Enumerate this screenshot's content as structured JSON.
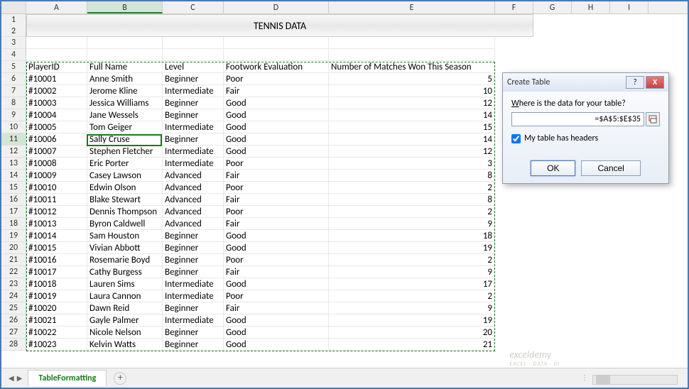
{
  "title_row": "TENNIS DATA",
  "columns": [
    "A",
    "B",
    "C",
    "D",
    "E",
    "F",
    "G",
    "H",
    "I"
  ],
  "selected_column": "B",
  "active_cell": {
    "row": 11,
    "col": "B"
  },
  "headers": {
    "playerid": "PlayerID",
    "fullname": "Full Name",
    "level": "Level",
    "footwork": "Footwork Evaluation",
    "matches": "Number of Matches Won This Season"
  },
  "rows": [
    {
      "n": 6,
      "id": "#10001",
      "name": "Anne Smith",
      "level": "Beginner",
      "foot": "Poor",
      "matches": 5
    },
    {
      "n": 7,
      "id": "#10002",
      "name": "Jerome Kline",
      "level": "Intermediate",
      "foot": "Fair",
      "matches": 10
    },
    {
      "n": 8,
      "id": "#10003",
      "name": "Jessica Williams",
      "level": "Beginner",
      "foot": "Good",
      "matches": 12
    },
    {
      "n": 9,
      "id": "#10004",
      "name": "Jane Wessels",
      "level": "Beginner",
      "foot": "Good",
      "matches": 14
    },
    {
      "n": 10,
      "id": "#10005",
      "name": "Tom Geiger",
      "level": "Intermediate",
      "foot": "Good",
      "matches": 15
    },
    {
      "n": 11,
      "id": "#10006",
      "name": "Sally Cruse",
      "level": "Beginner",
      "foot": "Good",
      "matches": 14
    },
    {
      "n": 12,
      "id": "#10007",
      "name": "Stephen Fletcher",
      "level": "Intermediate",
      "foot": "Good",
      "matches": 12
    },
    {
      "n": 13,
      "id": "#10008",
      "name": "Eric Porter",
      "level": "Intermediate",
      "foot": "Poor",
      "matches": 3
    },
    {
      "n": 14,
      "id": "#10009",
      "name": "Casey Lawson",
      "level": "Advanced",
      "foot": "Fair",
      "matches": 8
    },
    {
      "n": 15,
      "id": "#10010",
      "name": "Edwin Olson",
      "level": "Advanced",
      "foot": "Poor",
      "matches": 2
    },
    {
      "n": 16,
      "id": "#10011",
      "name": "Blake Stewart",
      "level": "Advanced",
      "foot": "Fair",
      "matches": 8
    },
    {
      "n": 17,
      "id": "#10012",
      "name": "Dennis Thompson",
      "level": "Advanced",
      "foot": "Poor",
      "matches": 2
    },
    {
      "n": 18,
      "id": "#10013",
      "name": "Byron Caldwell",
      "level": "Advanced",
      "foot": "Fair",
      "matches": 9
    },
    {
      "n": 19,
      "id": "#10014",
      "name": "Sam Houston",
      "level": "Beginner",
      "foot": "Good",
      "matches": 18
    },
    {
      "n": 20,
      "id": "#10015",
      "name": "Vivian Abbott",
      "level": "Beginner",
      "foot": "Good",
      "matches": 19
    },
    {
      "n": 21,
      "id": "#10016",
      "name": "Rosemarie Boyd",
      "level": "Beginner",
      "foot": "Poor",
      "matches": 2
    },
    {
      "n": 22,
      "id": "#10017",
      "name": "Cathy Burgess",
      "level": "Beginner",
      "foot": "Fair",
      "matches": 9
    },
    {
      "n": 23,
      "id": "#10018",
      "name": "Lauren Sims",
      "level": "Intermediate",
      "foot": "Good",
      "matches": 17
    },
    {
      "n": 24,
      "id": "#10019",
      "name": "Laura Cannon",
      "level": "Intermediate",
      "foot": "Poor",
      "matches": 2
    },
    {
      "n": 25,
      "id": "#10020",
      "name": "Dawn Reid",
      "level": "Beginner",
      "foot": "Fair",
      "matches": 9
    },
    {
      "n": 26,
      "id": "#10021",
      "name": "Gayle Palmer",
      "level": "Intermediate",
      "foot": "Good",
      "matches": 19
    },
    {
      "n": 27,
      "id": "#10022",
      "name": "Nicole Nelson",
      "level": "Beginner",
      "foot": "Good",
      "matches": 20
    },
    {
      "n": 28,
      "id": "#10023",
      "name": "Kelvin Watts",
      "level": "Beginner",
      "foot": "Good",
      "matches": 21
    }
  ],
  "sheet_tab": "TableFormatting",
  "dialog": {
    "title": "Create Table",
    "prompt": "Where is the data for your table?",
    "range": "=$A$5:$E$35",
    "checkbox_label": "My table has headers",
    "checkbox_hotkey": "M",
    "checked": true,
    "ok": "OK",
    "cancel": "Cancel",
    "help": "?",
    "close": "X"
  },
  "watermark": {
    "main": "exceldemy",
    "sub": "EXCEL · DATA · BI"
  }
}
